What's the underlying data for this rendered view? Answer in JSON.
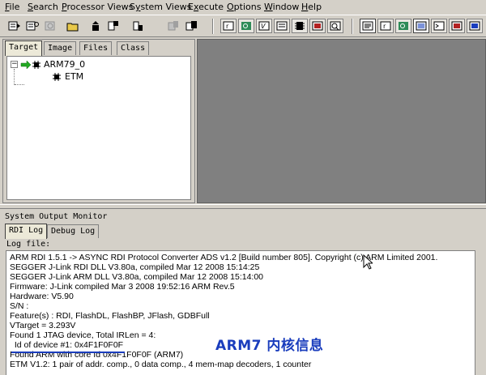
{
  "menu": [
    {
      "label": "File",
      "u": "F"
    },
    {
      "label": "Search",
      "u": "S"
    },
    {
      "label": "Processor Views",
      "u": "P"
    },
    {
      "label": "System Views",
      "u": "y"
    },
    {
      "label": "Execute",
      "u": "x"
    },
    {
      "label": "Options",
      "u": "O"
    },
    {
      "label": "Window",
      "u": "W"
    },
    {
      "label": "Help",
      "u": "H"
    }
  ],
  "left_tabs": [
    "Target",
    "Image",
    "Files",
    "Class"
  ],
  "tree": {
    "root": "ARM79_0",
    "child": "ETM"
  },
  "monitor": {
    "title": "System Output Monitor",
    "tabs": [
      "RDI Log",
      "Debug Log"
    ],
    "log_file_label": "Log file:",
    "lines": [
      "ARM RDI 1.5.1 -> ASYNC RDI Protocol Converter ADS v1.2 [Build number 805]. Copyright (c) ARM Limited 2001.",
      "SEGGER J-Link RDI DLL V3.80a, compiled Mar 12 2008 15:14:25",
      "SEGGER J-Link ARM DLL V3.80a, compiled Mar 12 2008 15:14:00",
      "Firmware: J-Link compiled Mar  3 2008 19:52:16 ARM Rev.5",
      "Hardware: V5.90",
      "S/N :",
      "Feature(s) : RDI, FlashDL, FlashBP, JFlash, GDBFull",
      "VTarget = 3.293V",
      "Found 1 JTAG device, Total IRLen = 4:",
      "  Id of device #1: 0x4F1F0F0F",
      "Found ARM with core Id 0x4F1F0F0F (ARM7)",
      "ETM V1.2: 1 pair of addr. comp., 0 data comp., 4 mem-map decoders, 1 counter"
    ],
    "annotation": "ARM7 内核信息"
  },
  "colors": {
    "annotation": "#1a3dbd",
    "workspace": "#808080",
    "chrome": "#d4d0c8"
  }
}
